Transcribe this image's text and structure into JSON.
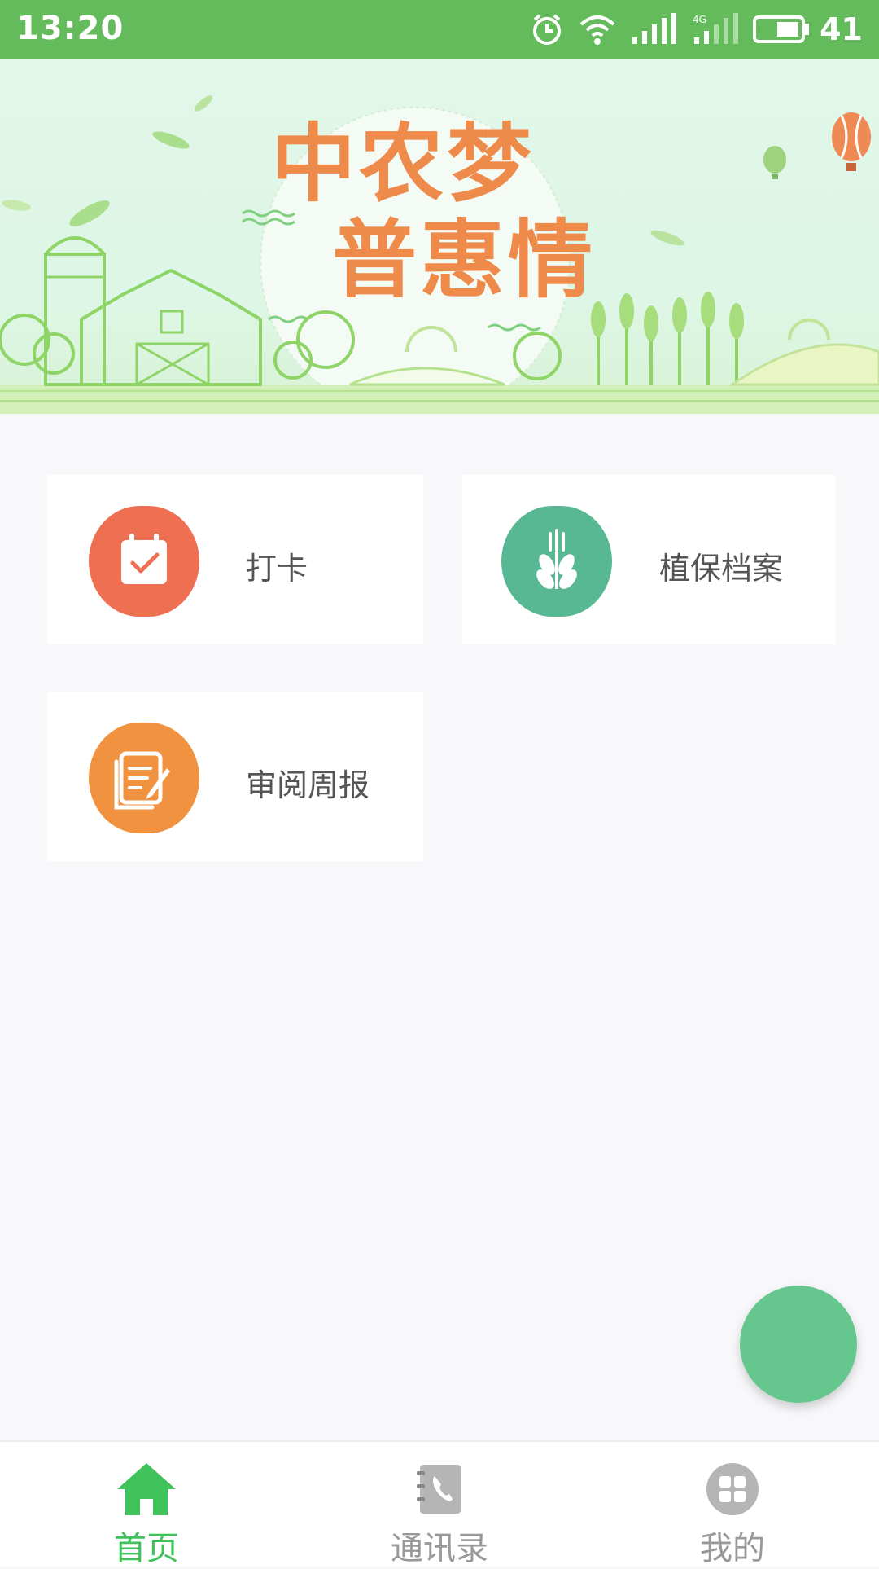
{
  "status_bar": {
    "time": "13:20",
    "battery": "41",
    "icons": [
      "alarm-icon",
      "wifi-icon",
      "signal-icon",
      "signal-4g-icon",
      "battery-icon"
    ]
  },
  "banner": {
    "line1": "中农梦",
    "line2": "普惠情"
  },
  "menu": [
    {
      "label": "打卡",
      "icon": "calendar-check-icon",
      "color": "#ee6f52"
    },
    {
      "label": "植保档案",
      "icon": "wheat-icon",
      "color": "#58b893"
    },
    {
      "label": "审阅周报",
      "icon": "report-edit-icon",
      "color": "#f0923f"
    }
  ],
  "bottom_nav": [
    {
      "label": "首页",
      "icon": "home-icon",
      "active": true,
      "color": "#3fc25a"
    },
    {
      "label": "通讯录",
      "icon": "contacts-icon",
      "active": false,
      "color": "#999999"
    },
    {
      "label": "我的",
      "icon": "profile-grid-icon",
      "active": false,
      "color": "#999999"
    }
  ],
  "colors": {
    "status_bar": "#63bb5b",
    "fab": "#66c78e",
    "banner_title": "#ee8a4a"
  }
}
